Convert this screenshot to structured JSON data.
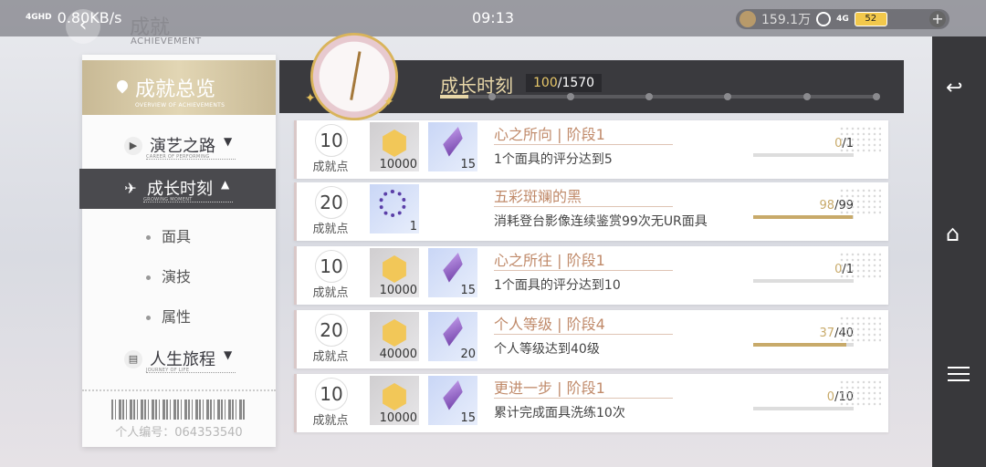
{
  "status_bar": {
    "signal": "4GHD",
    "net_speed": "0.80KB/s",
    "time": "09:13",
    "coins": "159.1万",
    "network": "4G",
    "battery": "52"
  },
  "page": {
    "title": "成就",
    "subtitle": "ACHIEVEMENT"
  },
  "sidebar": {
    "overview_title": "成就总览",
    "overview_sub": "OVERVIEW OF ACHIEVEMENTS",
    "items": [
      {
        "label": "演艺之路",
        "sub": "CAREER OF PERFORMING",
        "arrow": "▼"
      },
      {
        "label": "成长时刻",
        "sub": "GROWING MOMENT",
        "arrow": "▲"
      },
      {
        "label": "人生旅程",
        "sub": "JOURNEY OF LIFE",
        "arrow": "▼"
      }
    ],
    "subitems": [
      "面具",
      "演技",
      "属性"
    ],
    "player_id": "个人编号：064353540"
  },
  "header": {
    "title": "成长时刻",
    "progress_current": "100",
    "progress_total": "/1570",
    "progress_fraction": 0.064
  },
  "rows": [
    {
      "points": "10",
      "points_label": "成就点",
      "rewards": [
        {
          "type": "medal",
          "count": "10000"
        },
        {
          "type": "crystal",
          "count": "15"
        }
      ],
      "title": "心之所向 | 阶段1",
      "desc": "1个面具的评分达到5",
      "prog_current": "0",
      "prog_total": "/1",
      "fraction": 0.0
    },
    {
      "points": "20",
      "points_label": "成就点",
      "rewards": [
        {
          "type": "mask",
          "count": "1"
        }
      ],
      "title": "五彩斑斓的黑",
      "desc": "消耗登台影像连续鉴赏99次无UR面具",
      "prog_current": "98",
      "prog_total": "/99",
      "fraction": 0.99
    },
    {
      "points": "10",
      "points_label": "成就点",
      "rewards": [
        {
          "type": "medal",
          "count": "10000"
        },
        {
          "type": "crystal",
          "count": "15"
        }
      ],
      "title": "心之所往 | 阶段1",
      "desc": "1个面具的评分达到10",
      "prog_current": "0",
      "prog_total": "/1",
      "fraction": 0.0
    },
    {
      "points": "20",
      "points_label": "成就点",
      "rewards": [
        {
          "type": "medal",
          "count": "40000"
        },
        {
          "type": "crystal",
          "count": "20"
        }
      ],
      "title": "个人等级 | 阶段4",
      "desc": "个人等级达到40级",
      "prog_current": "37",
      "prog_total": "/40",
      "fraction": 0.925
    },
    {
      "points": "10",
      "points_label": "成就点",
      "rewards": [
        {
          "type": "medal",
          "count": "10000"
        },
        {
          "type": "crystal",
          "count": "15"
        }
      ],
      "title": "更进一步 | 阶段1",
      "desc": "累计完成面具洗练10次",
      "prog_current": "0",
      "prog_total": "/10",
      "fraction": 0.0
    }
  ],
  "colors": {
    "accent_gold": "#c8aa6a",
    "title_rose": "#c08a6a",
    "dark_bar": "#3a3a3e"
  },
  "icons": {
    "back": "back-arrow-icon",
    "home": "home-icon",
    "menu": "menu-icon"
  }
}
